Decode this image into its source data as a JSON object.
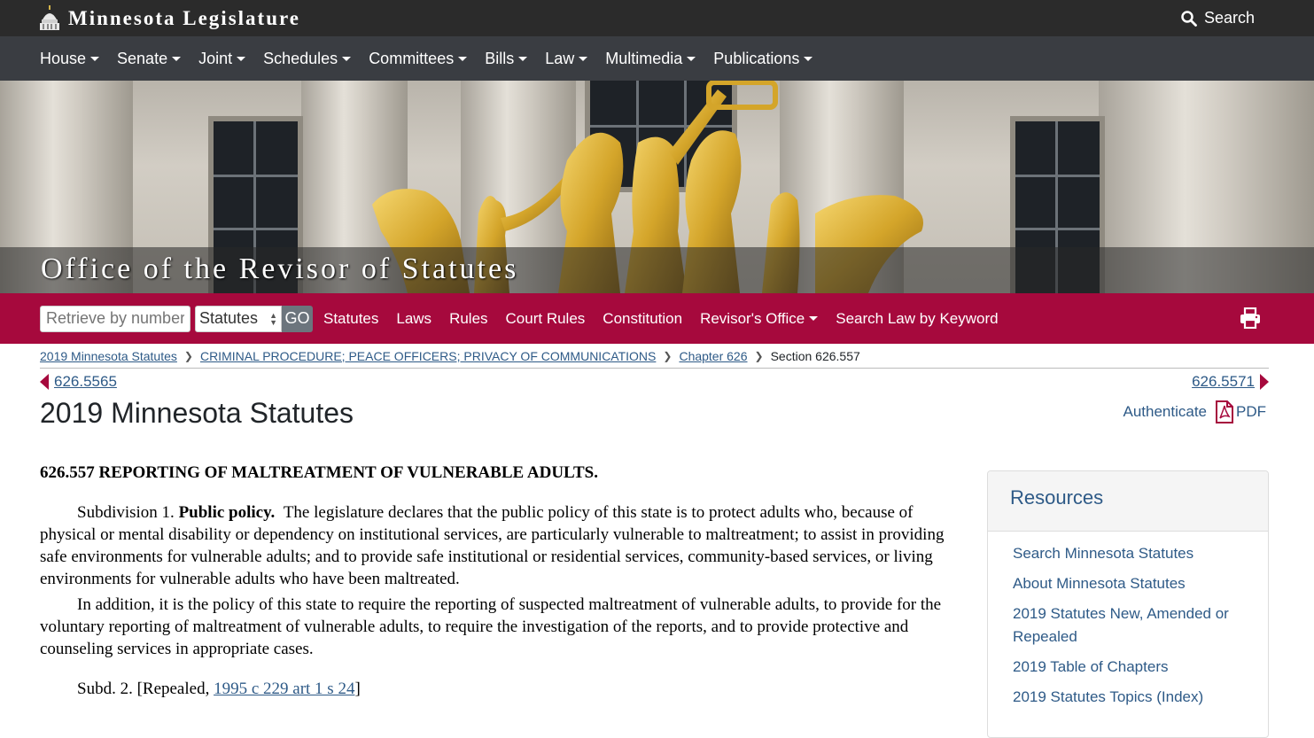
{
  "topbar": {
    "brand": "Minnesota Legislature",
    "search_label": "Search"
  },
  "mainnav": {
    "items": [
      "House",
      "Senate",
      "Joint",
      "Schedules",
      "Committees",
      "Bills",
      "Law",
      "Multimedia",
      "Publications"
    ]
  },
  "hero": {
    "title": "Office of the Revisor of Statutes"
  },
  "toolbar": {
    "retrieve_placeholder": "Retrieve by number",
    "select_value": "Statutes",
    "go_label": "GO",
    "links": [
      "Statutes",
      "Laws",
      "Rules",
      "Court Rules",
      "Constitution",
      "Revisor's Office",
      "Search Law by Keyword"
    ]
  },
  "breadcrumb": {
    "items": [
      "2019 Minnesota Statutes",
      "CRIMINAL PROCEDURE; PEACE OFFICERS; PRIVACY OF COMMUNICATIONS",
      "Chapter 626"
    ],
    "current": "Section 626.557"
  },
  "prevnext": {
    "prev": "626.5565",
    "next": "626.5571"
  },
  "page": {
    "title": "2019 Minnesota Statutes",
    "authenticate": "Authenticate",
    "pdf": "PDF"
  },
  "statute": {
    "heading": "626.557 REPORTING OF MALTREATMENT OF VULNERABLE ADULTS.",
    "subd1_label": "Subdivision 1.",
    "subd1_title": "Public policy.",
    "subd1_text": "The legislature declares that the public policy of this state is to protect adults who, because of physical or mental disability or dependency on institutional services, are particularly vulnerable to maltreatment; to assist in providing safe environments for vulnerable adults; and to provide safe institutional or residential services, community-based services, or living environments for vulnerable adults who have been maltreated.",
    "para2": "In addition, it is the policy of this state to require the reporting of suspected maltreatment of vulnerable adults, to provide for the voluntary reporting of maltreatment of vulnerable adults, to require the investigation of the reports, and to provide protective and counseling services in appropriate cases.",
    "subd2_prefix": "Subd. 2. [Repealed, ",
    "subd2_link": "1995 c 229 art 1 s 24",
    "subd2_suffix": "]"
  },
  "resources": {
    "title": "Resources",
    "items": [
      "Search Minnesota Statutes",
      "About Minnesota Statutes",
      "2019 Statutes New, Amended or Repealed",
      "2019 Table of Chapters",
      "2019 Statutes Topics (Index)"
    ]
  },
  "colors": {
    "topbar": "#2b2b2b",
    "nav": "#3a3d42",
    "accent_red": "#a6093d",
    "link_blue": "#2e5a87"
  }
}
